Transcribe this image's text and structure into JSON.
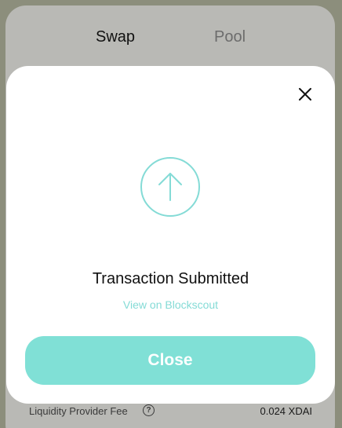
{
  "tabs": {
    "swap_label": "Swap",
    "pool_label": "Pool"
  },
  "modal": {
    "title": "Transaction Submitted",
    "explorer_link": "View on Blockscout",
    "close_button": "Close",
    "close_icon": "close-icon",
    "status_icon": "arrow-up-circle-icon"
  },
  "fee": {
    "label": "Liquidity Provider Fee",
    "help_icon": "question-circle-icon",
    "help_glyph": "?",
    "value": "0.024 XDAI"
  },
  "colors": {
    "accent": "#80e0d6",
    "link": "#84dbd6",
    "overlay": "#b9b9b5"
  }
}
